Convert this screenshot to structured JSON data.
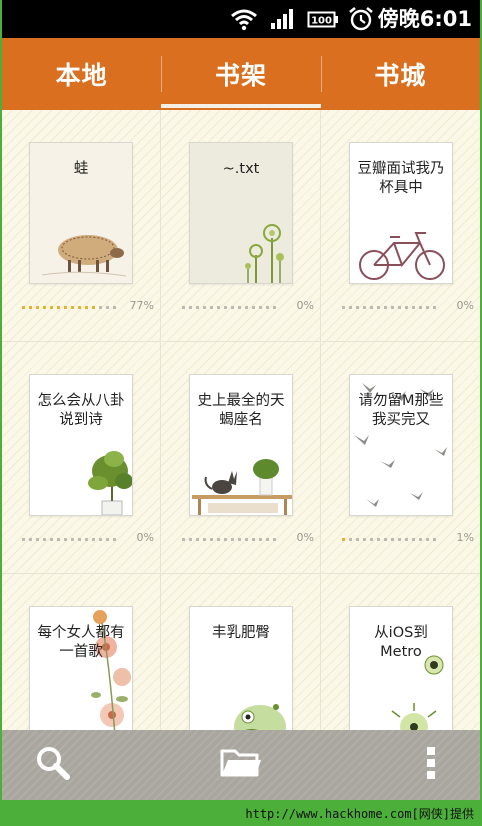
{
  "status_bar": {
    "icons": [
      "wifi-icon",
      "signal-icon",
      "battery-icon",
      "alarm-icon"
    ],
    "battery_text": "100",
    "time": "傍晚6:01"
  },
  "tabs": [
    {
      "label": "本地",
      "active": false
    },
    {
      "label": "书架",
      "active": true
    },
    {
      "label": "书城",
      "active": false
    }
  ],
  "books": [
    {
      "title": "蛙",
      "progress_text": "77%",
      "progress": 0.77,
      "art": "sheep"
    },
    {
      "title": "~.txt",
      "progress_text": "0%",
      "progress": 0,
      "art": "flowers"
    },
    {
      "title": "豆瓣面试我乃杯具中",
      "progress_text": "0%",
      "progress": 0,
      "art": "bicycle"
    },
    {
      "title": "怎么会从八卦说到诗",
      "progress_text": "0%",
      "progress": 0,
      "art": "plant"
    },
    {
      "title": "史上最全的天蝎座名",
      "progress_text": "0%",
      "progress": 0,
      "art": "cat-shelf"
    },
    {
      "title": "请勿留M那些我买完又",
      "progress_text": "1%",
      "progress": 0.01,
      "art": "birds"
    },
    {
      "title": "每个女人都有一首歌",
      "progress_text": "",
      "progress": 0,
      "art": "blossom"
    },
    {
      "title": "丰乳肥臀",
      "progress_text": "",
      "progress": 0,
      "art": "green-creature"
    },
    {
      "title": "从iOS到Metro",
      "progress_text": "",
      "progress": 0,
      "art": "spores"
    }
  ],
  "toolbar": {
    "icons": [
      "search-icon",
      "folder-icon",
      "more-icon"
    ]
  },
  "credit": "http://www.hackhome.com[网侠]提供",
  "colors": {
    "tab_bar": "#d96f1f",
    "shelf_bg": "#fbf8e8",
    "toolbar": "#a8a69e",
    "progress_on": "#e3b32b",
    "progress_off": "#bdbab2"
  }
}
